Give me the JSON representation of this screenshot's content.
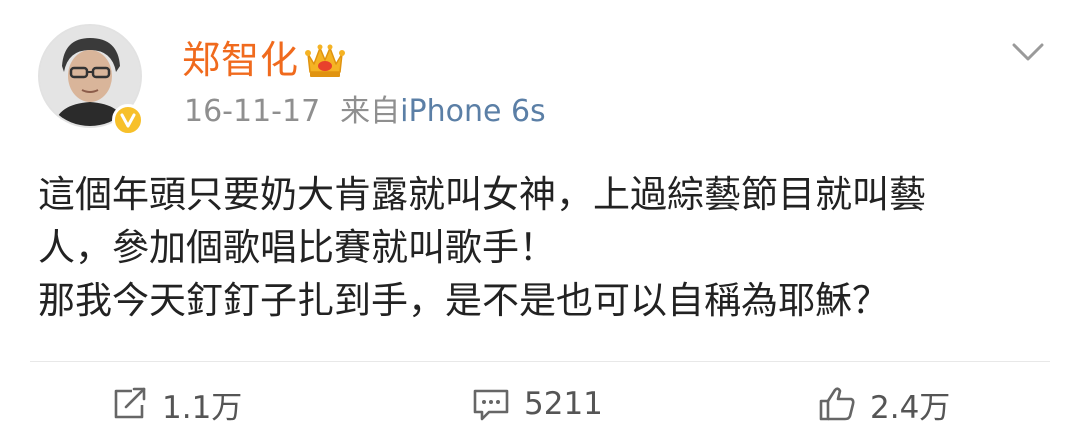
{
  "post": {
    "author": {
      "name": "郑智化",
      "avatar_icon": "avatar-photo",
      "badge_icon": "verified-badge-icon",
      "level_icon": "crown-icon"
    },
    "meta": {
      "time": "16-11-17",
      "source_prefix": "来自",
      "source_device": "iPhone 6s"
    },
    "menu_icon": "chevron-down-icon",
    "content": {
      "line1": "這個年頭只要奶大肯露就叫女神，上過綜藝節目就叫藝",
      "line2": "人，參加個歌唱比賽就叫歌手！",
      "line3": "那我今天釘釘子扎到手，是不是也可以自稱為耶穌？"
    },
    "actions": {
      "repost": {
        "icon": "share-icon",
        "count": "1.1万"
      },
      "comment": {
        "icon": "comment-icon",
        "count": "5211"
      },
      "like": {
        "icon": "thumbs-up-icon",
        "count": "2.4万"
      }
    },
    "colors": {
      "username": "#f06a1d",
      "meta": "#8f8f8f",
      "source_device": "#5b7fa6",
      "content": "#222222",
      "verified_badge": "#f7c02a"
    }
  }
}
